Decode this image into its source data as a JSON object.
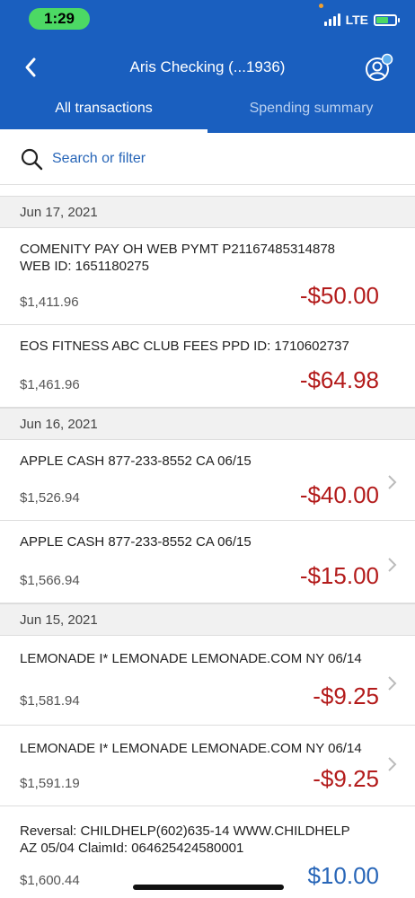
{
  "status": {
    "time": "1:29",
    "network": "LTE"
  },
  "header": {
    "title": "Aris Checking  (...1936)"
  },
  "tabs": [
    {
      "label": "All transactions",
      "active": true
    },
    {
      "label": "Spending summary",
      "active": false
    }
  ],
  "search": {
    "placeholder": "Search or filter"
  },
  "groups": [
    {
      "date": "Jun 17, 2021",
      "transactions": [
        {
          "line1": "COMENITY PAY OH WEB PYMT P21167485314878",
          "line2": "WEB ID: 1651180275",
          "balance": "$1,411.96",
          "amount": "-$50.00"
        },
        {
          "line1": "EOS FITNESS ABC CLUB FEES PPD ID: 1710602737",
          "line2": "",
          "balance": "$1,461.96",
          "amount": "-$64.98"
        }
      ]
    },
    {
      "date": "Jun 16, 2021",
      "transactions": [
        {
          "line1": "APPLE CASH 877-233-8552 CA 06/15",
          "line2": "",
          "balance": "$1,526.94",
          "amount": "-$40.00"
        },
        {
          "line1": "APPLE CASH 877-233-8552 CA 06/15",
          "line2": "",
          "balance": "$1,566.94",
          "amount": "-$15.00"
        }
      ]
    },
    {
      "date": "Jun 15, 2021",
      "transactions": [
        {
          "line1": "LEMONADE I* LEMONADE LEMONADE.COM NY 06/14",
          "line2": "",
          "balance": "$1,581.94",
          "amount": "-$9.25"
        },
        {
          "line1": "LEMONADE I* LEMONADE LEMONADE.COM NY 06/14",
          "line2": "",
          "balance": "$1,591.19",
          "amount": "-$9.25"
        },
        {
          "line1": "Reversal: CHILDHELP(602)635-14 WWW.CHILDHELP",
          "line2": "AZ 05/04 ClaimId: 064625424580001",
          "balance": "$1,600.44",
          "amount": "$10.00"
        }
      ]
    }
  ],
  "colors": {
    "header": "#1a5fbf",
    "debit": "#b31b1b",
    "credit": "#2866b8"
  }
}
